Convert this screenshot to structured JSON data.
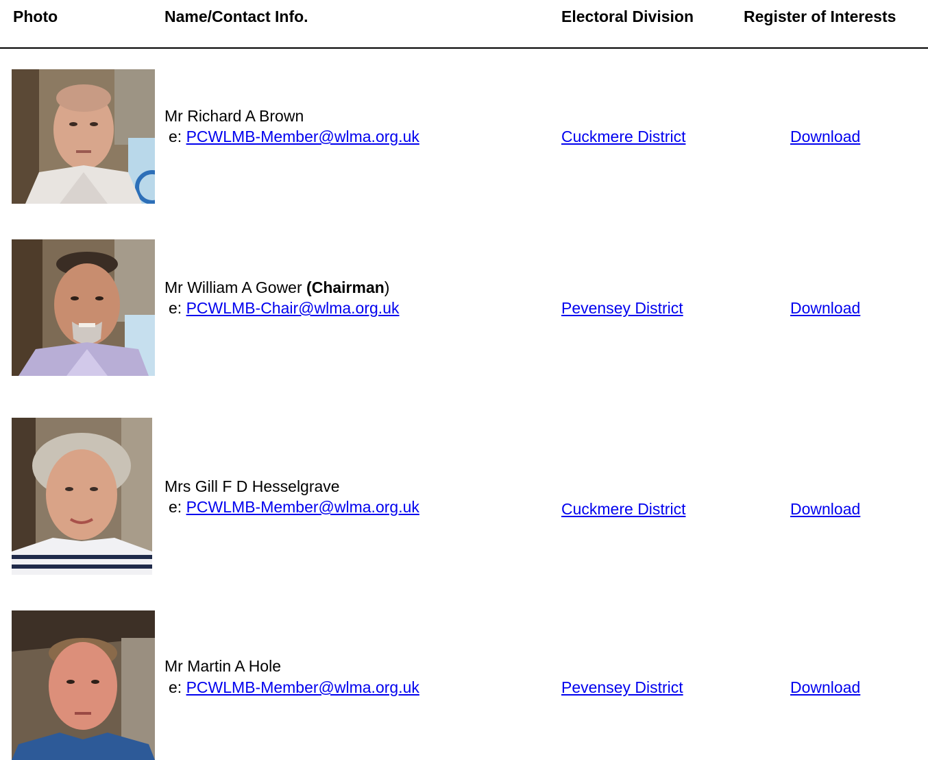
{
  "headers": {
    "photo": "Photo",
    "name_contact": "Name/Contact Info.",
    "division": "Electoral Division",
    "register": "Register of Interests"
  },
  "email_prefix": "e:",
  "members": [
    {
      "name": "Mr Richard A Brown",
      "role": "",
      "email": "PCWLMB-Member@wlma.org.uk",
      "division": "Cuckmere District",
      "register": "Download",
      "photo_icon": "portrait-photo"
    },
    {
      "name": "Mr William A Gower ",
      "role_open": "(",
      "role": "Chairman",
      "role_close": ")",
      "email": "PCWLMB-Chair@wlma.org.uk",
      "division": "Pevensey District",
      "register": "Download",
      "photo_icon": "portrait-photo"
    },
    {
      "name": "Mrs Gill F D Hesselgrave",
      "role": "",
      "email": "PCWLMB-Member@wlma.org.uk",
      "division": "Cuckmere District",
      "register": "Download",
      "photo_icon": "portrait-photo"
    },
    {
      "name": "Mr Martin A Hole",
      "role": "",
      "email": "PCWLMB-Member@wlma.org.uk",
      "division": "Pevensey District",
      "register": "Download",
      "photo_icon": "portrait-photo"
    }
  ],
  "colors": {
    "link": "#0000ee",
    "text": "#000000",
    "rule": "#000000"
  }
}
